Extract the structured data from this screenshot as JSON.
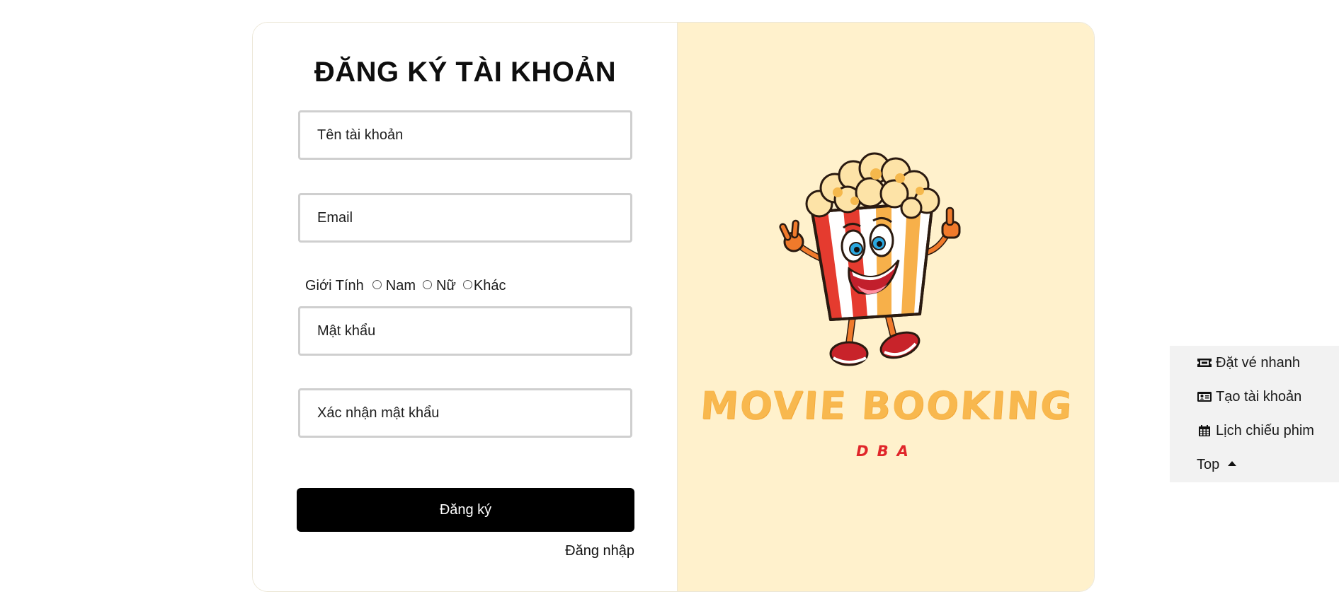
{
  "register": {
    "title": "ĐĂNG KÝ TÀI KHOẢN",
    "username_placeholder": "Tên tài khoản",
    "email_placeholder": "Email",
    "gender_label": "Giới Tính",
    "gender_options": [
      "Nam",
      "Nữ",
      "Khác"
    ],
    "password_placeholder": "Mật khẩu",
    "confirm_password_placeholder": "Xác nhận mật khẩu",
    "submit_label": "Đăng ký",
    "login_link": "Đăng nhập"
  },
  "brand": {
    "name": "MOVIE BOOKING",
    "subtitle": "DBA",
    "mascot_icon": "popcorn-mascot-icon",
    "colors": {
      "panel_bg": "#fff1cc",
      "name": "#f8b84e",
      "subtitle": "#e0262a"
    }
  },
  "quick_menu": {
    "items": [
      {
        "label": "Đặt vé nhanh",
        "icon": "ticket-icon"
      },
      {
        "label": "Tạo tài khoản",
        "icon": "id-card-icon"
      },
      {
        "label": "Lịch chiếu phim",
        "icon": "calendar-icon"
      },
      {
        "label": "Top",
        "icon": "caret-up-icon"
      }
    ]
  }
}
